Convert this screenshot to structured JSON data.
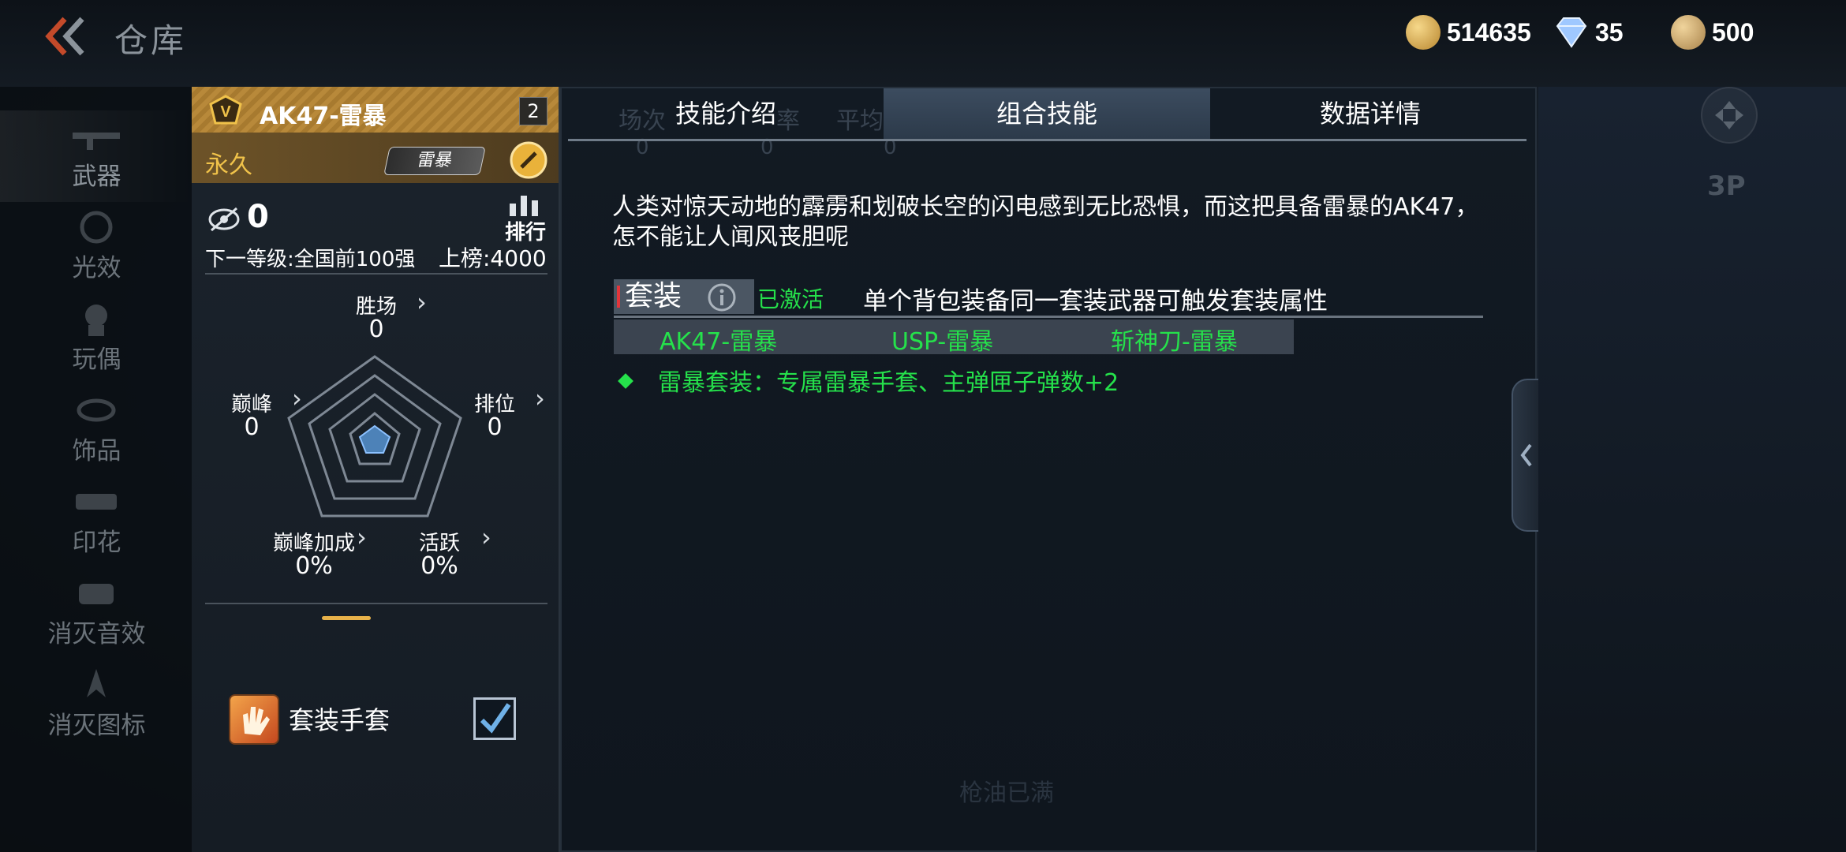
{
  "header": {
    "title": "仓库",
    "currencies": [
      {
        "icon": "gold-coin-icon",
        "value": "514635"
      },
      {
        "icon": "diamond-icon",
        "value": "35"
      },
      {
        "icon": "token-coin-icon",
        "value": "500"
      }
    ]
  },
  "sidebar": {
    "items": [
      {
        "label": "武器",
        "icon": "rifle-icon"
      },
      {
        "label": "光效",
        "icon": "glow-icon"
      },
      {
        "label": "玩偶",
        "icon": "doll-icon"
      },
      {
        "label": "饰品",
        "icon": "accessory-icon"
      },
      {
        "label": "印花",
        "icon": "decal-icon"
      },
      {
        "label": "消灭音效",
        "icon": "kill-sound-icon"
      },
      {
        "label": "消灭图标",
        "icon": "kill-icon"
      }
    ]
  },
  "card": {
    "weapon_name": "AK47-雷暴",
    "star_level": "2",
    "duration": "永久",
    "skin_tag": "雷暴",
    "rank_value": "0",
    "leaderboard_label": "排行",
    "next_level": "下一等级:全国前100强",
    "on_board": "上榜:4000",
    "radar": {
      "wins_label": "胜场",
      "wins_value": "0",
      "peak_label": "巅峰",
      "peak_value": "0",
      "ranked_label": "排位",
      "ranked_value": "0",
      "peak_bonus_label": "巅峰加成",
      "peak_bonus_value": "0%",
      "active_label": "活跃",
      "active_value": "0%"
    },
    "glove_label": "套装手套"
  },
  "tabs": [
    {
      "label": "技能介绍",
      "active": false
    },
    {
      "label": "组合技能",
      "active": true
    },
    {
      "label": "数据详情",
      "active": false
    }
  ],
  "ghost_headers": [
    "场次",
    "率",
    "平均KDA"
  ],
  "ghost_values": [
    "0",
    "0",
    "0"
  ],
  "content": {
    "description": "人类对惊天动地的霹雳和划破长空的闪电感到无比恐惧，而这把具备雷暴的AK47，怎不能让人闻风丧胆呢",
    "set_title": "套装",
    "activated": "已激活",
    "set_desc": "单个背包装备同一套装武器可触发套装属性",
    "set_items": [
      "AK47-雷暴",
      "USP-雷暴",
      "斩神刀-雷暴"
    ],
    "bonus": "雷暴套装：专属雷暴手套、主弹匣子弹数+2",
    "faint_bottom": "枪油已满"
  },
  "right": {
    "view_mode": "3P"
  },
  "colors": {
    "accent_green": "#25e14b",
    "gold": "#f0c24a",
    "highlight": "#e2353b"
  }
}
